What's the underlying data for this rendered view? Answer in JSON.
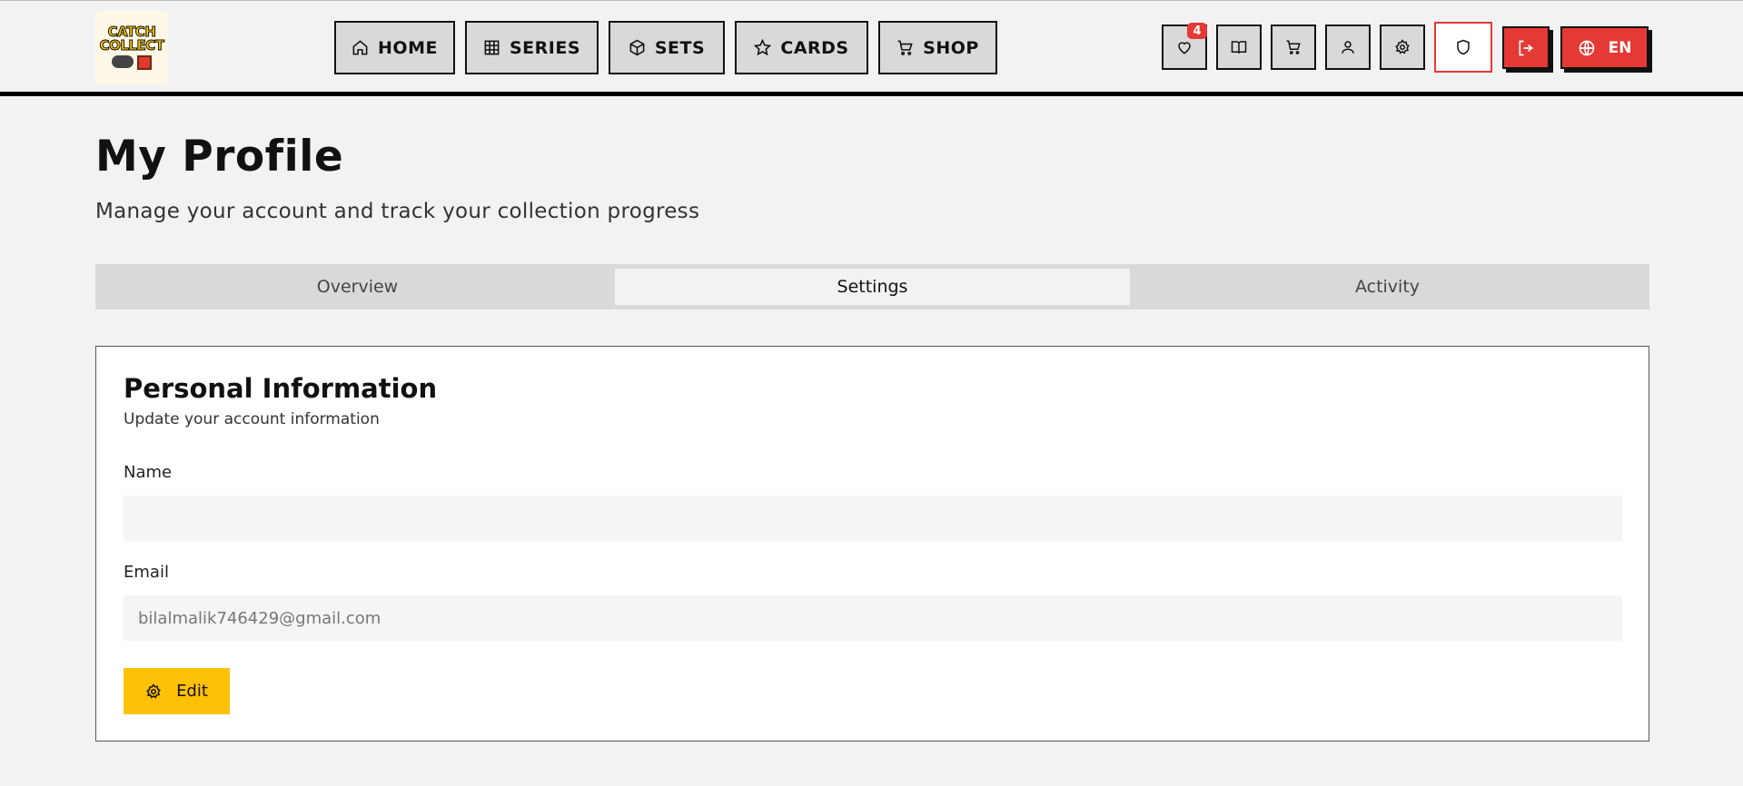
{
  "header": {
    "logo": {
      "line1": "CATCH",
      "line2": "COLLECT"
    },
    "nav": [
      {
        "label": "HOME",
        "icon": "home-icon"
      },
      {
        "label": "SERIES",
        "icon": "grid-icon"
      },
      {
        "label": "SETS",
        "icon": "box-icon"
      },
      {
        "label": "CARDS",
        "icon": "star-icon"
      },
      {
        "label": "SHOP",
        "icon": "cart-icon"
      }
    ],
    "wishlist_count": "4",
    "language_label": "EN"
  },
  "page": {
    "title": "My Profile",
    "subtitle": "Manage your account and track your collection progress"
  },
  "tabs": [
    {
      "label": "Overview",
      "active": false
    },
    {
      "label": "Settings",
      "active": true
    },
    {
      "label": "Activity",
      "active": false
    }
  ],
  "personal_info": {
    "title": "Personal Information",
    "subtitle": "Update your account information",
    "name_label": "Name",
    "name_value": "",
    "email_label": "Email",
    "email_value": "bilalmalik746429@gmail.com",
    "edit_label": "Edit"
  },
  "colors": {
    "accent_red": "#e53935",
    "accent_yellow": "#ffc107",
    "background": "#f2f2f2"
  }
}
